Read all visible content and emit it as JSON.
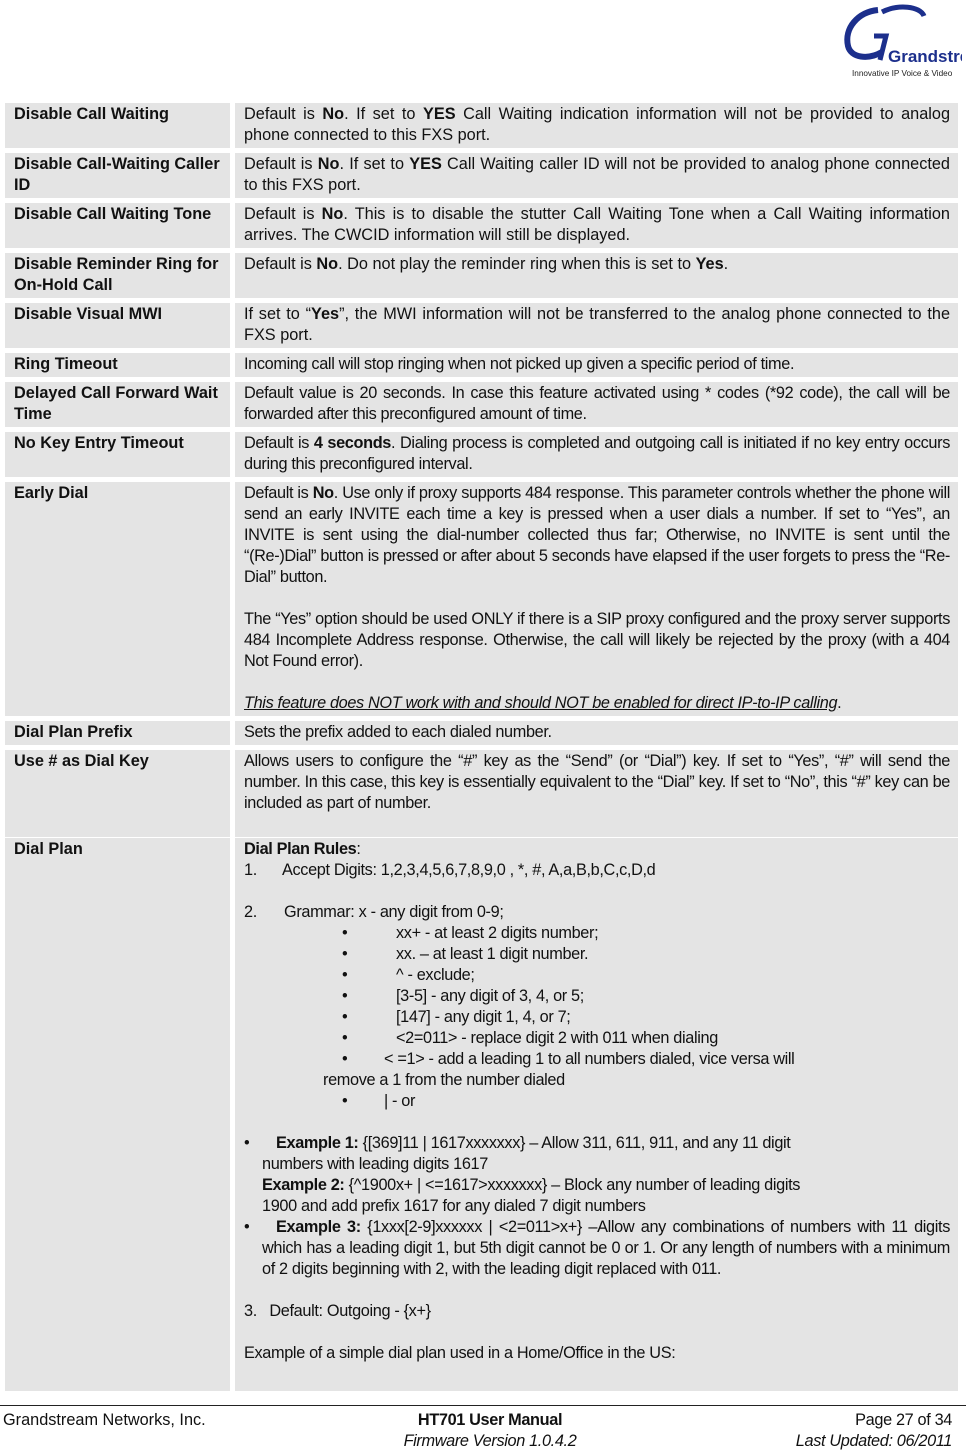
{
  "header": {
    "logo_name": "Grandstream",
    "logo_tagline": "Innovative IP Voice & Video"
  },
  "table1": [
    {
      "label": "Disable Call Waiting",
      "desc": [
        {
          "t": "Default is "
        },
        {
          "t": "No",
          "b": true
        },
        {
          "t": ". If set to "
        },
        {
          "t": "YES",
          "b": true
        },
        {
          "t": " Call Waiting indication information will not be provided to analog phone connected to this FXS port."
        }
      ]
    },
    {
      "label": "Disable Call-Waiting Caller ID",
      "desc": [
        {
          "t": "Default is "
        },
        {
          "t": "No",
          "b": true
        },
        {
          "t": ". If set to "
        },
        {
          "t": "YES",
          "b": true
        },
        {
          "t": " Call Waiting caller ID will not be provided to analog phone connected to this FXS port."
        }
      ]
    },
    {
      "label": "Disable Call Waiting Tone",
      "desc": [
        {
          "t": "Default is "
        },
        {
          "t": "No",
          "b": true
        },
        {
          "t": ". This is to disable the stutter Call Waiting Tone when a Call Waiting information arrives. The CWCID information will still be displayed."
        }
      ]
    },
    {
      "label": "Disable Reminder Ring for On-Hold Call",
      "desc": [
        {
          "t": "Default is "
        },
        {
          "t": "No",
          "b": true
        },
        {
          "t": ". Do not play the reminder ring when this is set to "
        },
        {
          "t": "Yes",
          "b": true
        },
        {
          "t": "."
        }
      ]
    },
    {
      "label": "Disable Visual MWI",
      "desc": [
        {
          "t": "If set to “"
        },
        {
          "t": "Yes",
          "b": true
        },
        {
          "t": "”, the MWI information will not be transferred to the analog phone connected to the FXS port."
        }
      ]
    },
    {
      "label": "Ring Timeout",
      "narrow": true,
      "desc": [
        {
          "t": "Incoming call will stop ringing when not picked up given a specific period of time."
        }
      ]
    },
    {
      "label": "Delayed Call Forward Wait Time",
      "narrow": true,
      "desc": [
        {
          "t": "Default value is 20 seconds. In case this feature activated using * codes (*92 code), the call will be forwarded after this preconfigured amount of time."
        }
      ]
    },
    {
      "label": "No Key Entry Timeout",
      "narrow": true,
      "desc": [
        {
          "t": "Default is "
        },
        {
          "t": "4 seconds",
          "b": true
        },
        {
          "t": ". Dialing process is completed and outgoing call is initiated if no key entry occurs during this preconfigured interval."
        }
      ]
    }
  ],
  "early_dial": {
    "label": "Early Dial",
    "para1": [
      {
        "t": "Default is "
      },
      {
        "t": "No",
        "b": true
      },
      {
        "t": ". Use only if proxy supports 484 response.  This parameter controls whether the phone will send an early INVITE each time a key is pressed when a user dials a number.   If set to “Yes”, an INVITE is sent using the dial-number collected thus far;   Otherwise, no INVITE is sent until the “(Re-)Dial” button is pressed or after about 5 seconds have elapsed if the user forgets to press the “Re-Dial” button."
      }
    ],
    "para2": "The “Yes” option should be used ONLY if there is a SIP proxy configured and the proxy server supports 484 Incomplete Address response. Otherwise, the call will likely be rejected by the proxy (with a 404 Not Found error).",
    "note": "This feature does NOT work with and should NOT be enabled for direct IP-to-IP calling",
    "note_end": "."
  },
  "dial_plan_prefix": {
    "label": "Dial Plan Prefix",
    "desc": "Sets the prefix added to each dialed number."
  },
  "use_hash": {
    "label": "Use # as Dial Key",
    "desc": "Allows users to configure the “#” key as the “Send” (or “Dial”) key.   If set to “Yes”, “#” will send the number.   In this case, this key is essentially equivalent to the “Dial” key. If set to “No”, this “#” key can be included as part of number."
  },
  "dial_plan": {
    "label": "Dial Plan",
    "rules_title": "Dial Plan Rules",
    "rules_colon": ":",
    "item1_num": "1.",
    "item1_text": "Accept Digits: 1,2,3,4,5,6,7,8,9,0 , *, #, A,a,B,b,C,c,D,d",
    "item2_num": "2.",
    "item2_text": "Grammar: x - any digit from 0-9;",
    "grammar": [
      "xx+ - at least 2 digits number;",
      "xx. – at least 1 digit number.",
      "^ - exclude;",
      "[3-5] - any digit of 3, 4, or 5;",
      "[147] - any digit 1, 4, or 7;",
      "<2=011> - replace digit 2 with 011 when dialing"
    ],
    "grammar_wrap_1": "< =1> - add a leading 1 to all numbers dialed, vice versa will",
    "grammar_wrap_2": "remove a 1 from the number dialed",
    "grammar_or": "| - or",
    "ex1_label": "Example 1:",
    "ex1_text": " {[369]11 | 1617xxxxxxx} – Allow 311, 611, 911, and any 11 digit",
    "ex1_text2": "numbers with leading digits 1617",
    "ex2_label": "Example 2:",
    "ex2_text": " {^1900x+ | <=1617>xxxxxxx} – Block any number of leading digits",
    "ex2_text2": "1900 and add prefix 1617 for any dialed 7 digit numbers",
    "ex3_label": "Example 3:",
    "ex3_text": " {1xxx[2-9]xxxxxx | <2=011>x+} –Allow any combinations of numbers with 11 digits which has a leading digit 1, but 5th digit cannot be 0 or 1. Or any length of numbers with a minimum of 2 digits beginning with 2, with the leading digit replaced with 011.",
    "item3": "3.   Default: Outgoing - {x+}",
    "example_simple": "Example of a simple dial plan used in a Home/Office in the US:"
  },
  "footer": {
    "company": "Grandstream Networks, Inc.",
    "manual": "HT701 User Manual",
    "firmware": "Firmware Version 1.0.4.2",
    "page": "Page 27 of 34",
    "updated": "Last Updated: 06/2011"
  }
}
